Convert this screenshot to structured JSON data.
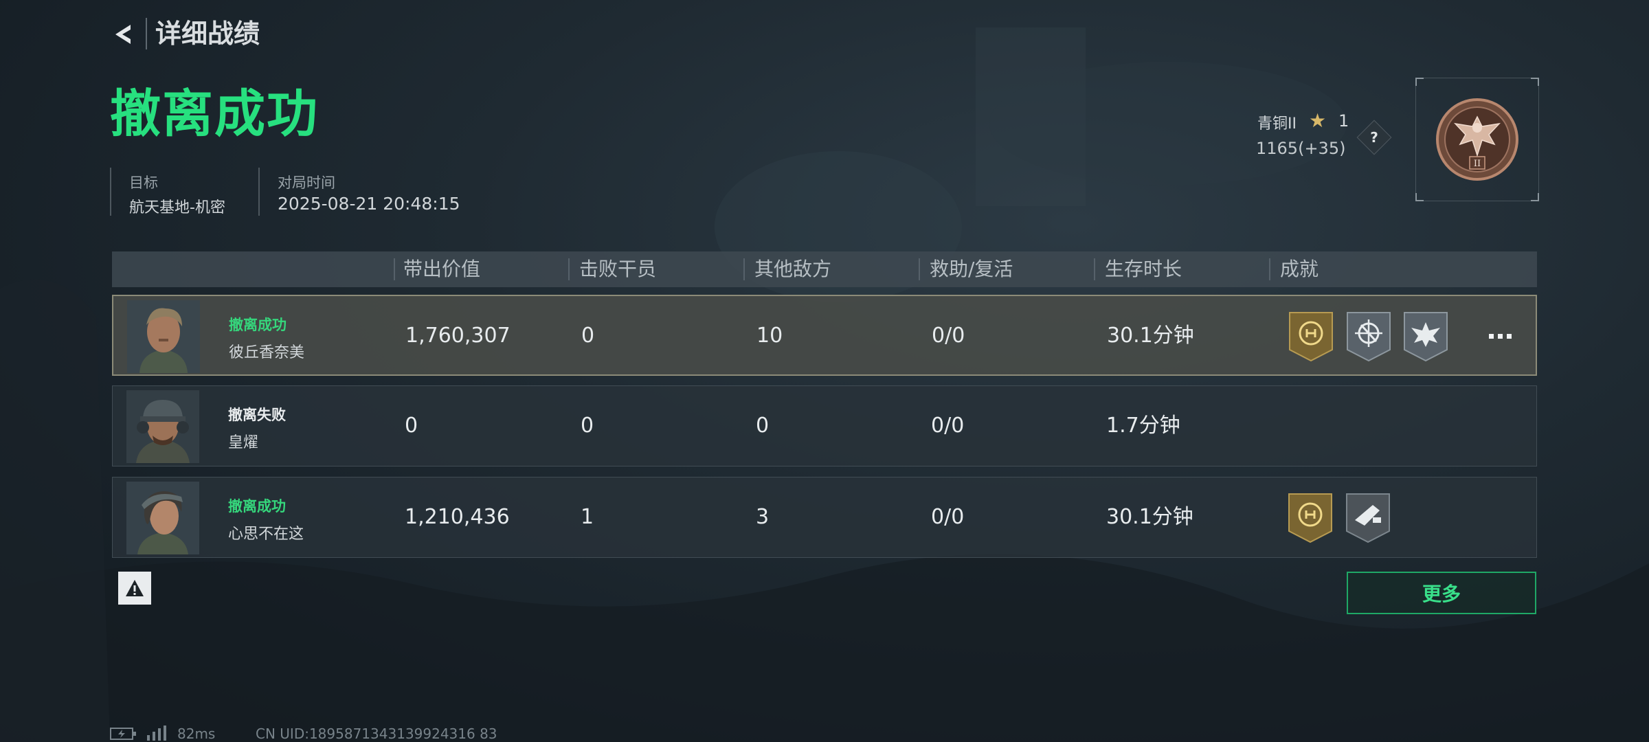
{
  "header": {
    "back_icon": "back-chevron-icon",
    "title": "详细战绩"
  },
  "result": {
    "title": "撤离成功",
    "color": "#27e07f"
  },
  "meta": {
    "target_label": "目标",
    "target_value": "航天基地-机密",
    "time_label": "对局时间",
    "time_value": "2025-08-21 20:48:15"
  },
  "rank": {
    "name": "青铜II",
    "stars": "1",
    "score": "1165(+35)",
    "help_label": "?",
    "badge_icon": "bronze-eagle-rank-badge-icon",
    "badge_numeral": "II"
  },
  "table": {
    "headers": [
      "带出价值",
      "击败干员",
      "其他敌方",
      "救助/复活",
      "生存时长",
      "成就"
    ],
    "rows": [
      {
        "status": "撤离成功",
        "status_color": "#35d77c",
        "name": "彼丘香奈美",
        "value": "1,760,307",
        "kills": "0",
        "other": "10",
        "assist": "0/0",
        "survival": "30.1分钟",
        "achievements": [
          "gold-extraction-achievement-icon",
          "grey-crosshair-achievement-icon",
          "grey-eagle-achievement-icon"
        ],
        "selected": true
      },
      {
        "status": "撤离失败",
        "status_color": "#e9ecee",
        "name": "皇燿",
        "value": "0",
        "kills": "0",
        "other": "0",
        "assist": "0/0",
        "survival": "1.7分钟",
        "achievements": [],
        "selected": false
      },
      {
        "status": "撤离成功",
        "status_color": "#35d77c",
        "name": "心思不在这",
        "value": "1,210,436",
        "kills": "1",
        "other": "3",
        "assist": "0/0",
        "survival": "30.1分钟",
        "achievements": [
          "gold-extraction-achievement-icon",
          "grey-weapon-achievement-icon"
        ],
        "selected": false
      }
    ]
  },
  "more_button": {
    "label": "更多"
  },
  "footer": {
    "ping": "82ms",
    "uid": "CN UID:1895871343139924316 83"
  }
}
